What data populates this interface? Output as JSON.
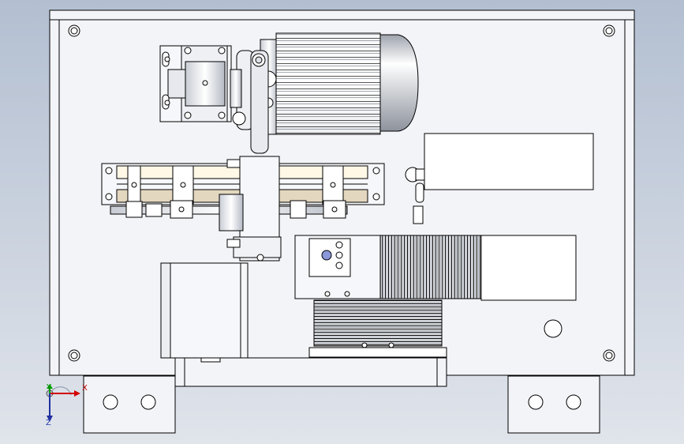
{
  "viewport": {
    "background_top": "#b3bfd1",
    "background_bottom": "#dfe3ea",
    "part_face": "#f3f4f8",
    "edge_color": "#000000"
  },
  "triad": {
    "x_label": "X",
    "y_label": "Y",
    "z_label": "Z",
    "x_color": "#d40000",
    "y_color": "#00a000",
    "z_color": "#2030a0"
  }
}
